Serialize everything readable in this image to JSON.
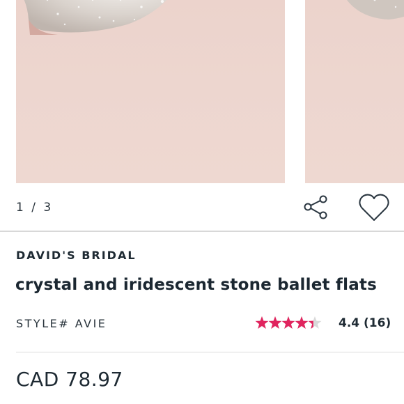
{
  "gallery": {
    "counter": "1 / 3",
    "current_index": 1,
    "total_images": 3
  },
  "actions": {
    "share_icon": "share-icon",
    "favorite_icon": "heart-icon"
  },
  "product": {
    "brand": "DAVID'S BRIDAL",
    "title": "crystal and iridescent stone ballet flats",
    "style": "STYLE# AVIE",
    "rating": {
      "value": 4.4,
      "max": 5,
      "display": "4.4 (16)",
      "star_color": "#e0245e"
    },
    "price": "CAD 78.97"
  }
}
